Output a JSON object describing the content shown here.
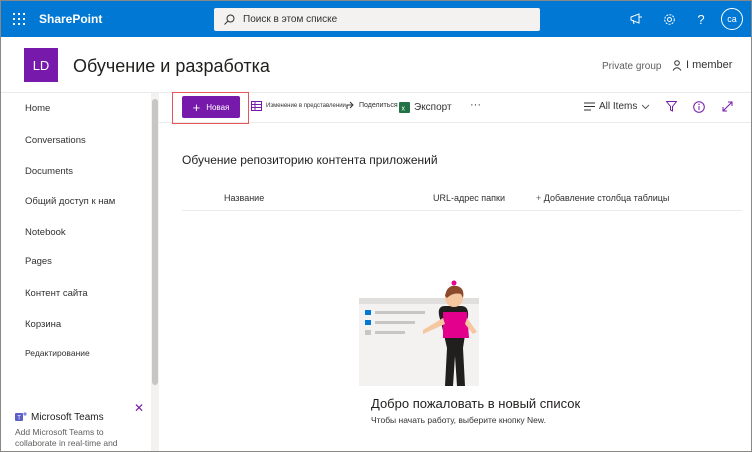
{
  "suitebar": {
    "brand": "SharePoint",
    "search_placeholder": "Поиск в этом списке",
    "avatar_initials": "ca"
  },
  "site": {
    "logo_initials": "LD",
    "title": "Обучение и разработка",
    "group_type": "Private group",
    "members": "I member"
  },
  "nav": {
    "items": [
      {
        "label": "Home"
      },
      {
        "label": "Conversations"
      },
      {
        "label": "Documents"
      },
      {
        "label": "Общий доступ к нам"
      },
      {
        "label": "Notebook"
      },
      {
        "label": "Pages"
      },
      {
        "label": "Контент сайта"
      },
      {
        "label": "Корзина"
      },
      {
        "label": "Редактирование"
      }
    ],
    "teams": {
      "title": "Microsoft Teams",
      "desc": "Add Microsoft Teams to collaborate in real-time and"
    }
  },
  "commandbar": {
    "new_label": "Новая",
    "edit_view": "Изменение в представлении",
    "share": "Поделиться",
    "export": "Экспорт",
    "more": "···",
    "view": "All Items"
  },
  "list": {
    "title": "Обучение репозиторию контента приложений",
    "columns": {
      "name": "Название",
      "url": "URL-адрес папки",
      "add": "Добавление столбца таблицы"
    },
    "empty_title": "Добро пожаловать в новый список",
    "empty_sub": "Чтобы начать работу, выберите кнопку New."
  },
  "colors": {
    "suitebar": "#0078d4",
    "accent": "#7719aa",
    "highlight": "#e8555d"
  }
}
